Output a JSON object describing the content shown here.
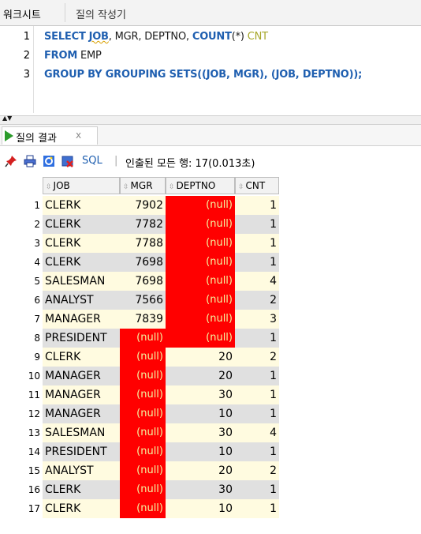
{
  "tabs": {
    "worksheet": "워크시트",
    "query_builder": "질의 작성기"
  },
  "editor": {
    "line_numbers": [
      "1",
      "2",
      "3"
    ],
    "line1": {
      "select": "SELECT",
      "job": "JOB",
      "rest": ", MGR, DEPTNO, ",
      "count": "COUNT",
      "star": "(*) ",
      "alias": "CNT"
    },
    "line2": {
      "from": "FROM",
      "table": " EMP"
    },
    "line3": {
      "group": "GROUP BY GROUPING SETS((JOB, MGR), (JOB, DEPTNO));"
    }
  },
  "results_tab": {
    "label": "질의 결과",
    "close": "x"
  },
  "toolbar": {
    "sql_label": "SQL",
    "separator": "|",
    "status": "인출된 모든 행: 17(0.013초)"
  },
  "columns": [
    "JOB",
    "MGR",
    "DEPTNO",
    "CNT"
  ],
  "null_text": "(null)",
  "rows": [
    {
      "n": "1",
      "job": "CLERK",
      "mgr": "7902",
      "deptno": "(null)",
      "cnt": "1"
    },
    {
      "n": "2",
      "job": "CLERK",
      "mgr": "7782",
      "deptno": "(null)",
      "cnt": "1"
    },
    {
      "n": "3",
      "job": "CLERK",
      "mgr": "7788",
      "deptno": "(null)",
      "cnt": "1"
    },
    {
      "n": "4",
      "job": "CLERK",
      "mgr": "7698",
      "deptno": "(null)",
      "cnt": "1"
    },
    {
      "n": "5",
      "job": "SALESMAN",
      "mgr": "7698",
      "deptno": "(null)",
      "cnt": "4"
    },
    {
      "n": "6",
      "job": "ANALYST",
      "mgr": "7566",
      "deptno": "(null)",
      "cnt": "2"
    },
    {
      "n": "7",
      "job": "MANAGER",
      "mgr": "7839",
      "deptno": "(null)",
      "cnt": "3"
    },
    {
      "n": "8",
      "job": "PRESIDENT",
      "mgr": "(null)",
      "deptno": "(null)",
      "cnt": "1"
    },
    {
      "n": "9",
      "job": "CLERK",
      "mgr": "(null)",
      "deptno": "20",
      "cnt": "2"
    },
    {
      "n": "10",
      "job": "MANAGER",
      "mgr": "(null)",
      "deptno": "20",
      "cnt": "1"
    },
    {
      "n": "11",
      "job": "MANAGER",
      "mgr": "(null)",
      "deptno": "30",
      "cnt": "1"
    },
    {
      "n": "12",
      "job": "MANAGER",
      "mgr": "(null)",
      "deptno": "10",
      "cnt": "1"
    },
    {
      "n": "13",
      "job": "SALESMAN",
      "mgr": "(null)",
      "deptno": "30",
      "cnt": "4"
    },
    {
      "n": "14",
      "job": "PRESIDENT",
      "mgr": "(null)",
      "deptno": "10",
      "cnt": "1"
    },
    {
      "n": "15",
      "job": "ANALYST",
      "mgr": "(null)",
      "deptno": "20",
      "cnt": "2"
    },
    {
      "n": "16",
      "job": "CLERK",
      "mgr": "(null)",
      "deptno": "30",
      "cnt": "1"
    },
    {
      "n": "17",
      "job": "CLERK",
      "mgr": "(null)",
      "deptno": "10",
      "cnt": "1"
    }
  ],
  "colors": {
    "null_bg": "#ff0000",
    "odd_row": "#fffbe0",
    "even_row": "#e0e0e0",
    "keyword": "#1f5fb0"
  }
}
